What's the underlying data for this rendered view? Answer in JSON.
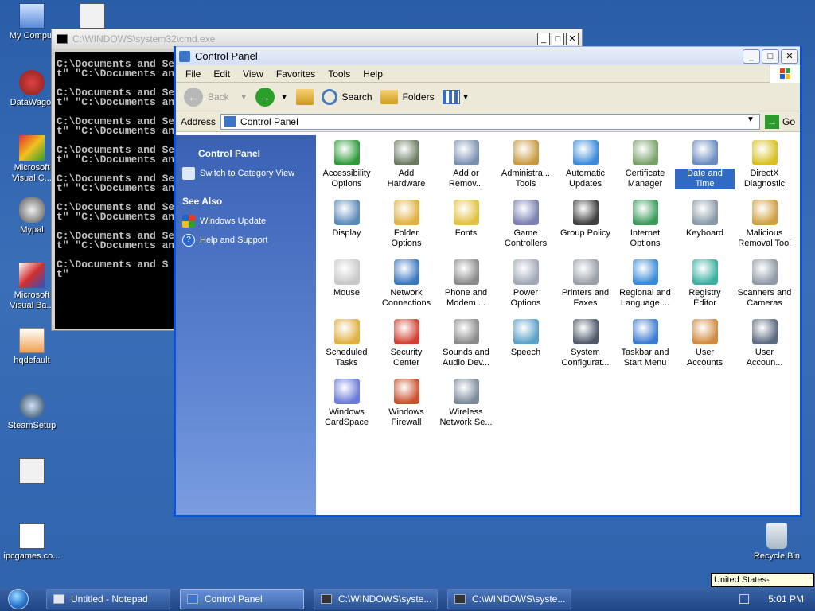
{
  "desktop": {
    "icons": [
      {
        "label": "My Comput",
        "icon": "my-computer-icon"
      },
      {
        "label": "",
        "icon": "cmd-shortcut-icon"
      },
      {
        "label": "DataWago.",
        "icon": "datawago-icon"
      },
      {
        "label": "Microsoft\nVisual C...",
        "icon": "visual-c-icon"
      },
      {
        "label": "Mypal",
        "icon": "mypal-icon"
      },
      {
        "label": "Microsoft\nVisual Ba...",
        "icon": "visual-basic-icon"
      },
      {
        "label": "hqdefault",
        "icon": "image-file-icon"
      },
      {
        "label": "SteamSetup",
        "icon": "steam-icon"
      },
      {
        "label": "",
        "icon": "app-shortcut-icon"
      },
      {
        "label": "ipcgames.co...",
        "icon": "text-file-icon"
      },
      {
        "label": "Recycle Bin",
        "icon": "recycle-bin-icon"
      }
    ]
  },
  "cmd_window": {
    "title": "C:\\WINDOWS\\system32\\cmd.exe",
    "lines": "C:\\Documents and Se\nt\" \"C:\\Documents an\n\nC:\\Documents and Se\nt\" \"C:\\Documents an\n\nC:\\Documents and Se\nt\" \"C:\\Documents an\n\nC:\\Documents and Se\nt\" \"C:\\Documents an\n\nC:\\Documents and Se\nt\" \"C:\\Documents an\n\nC:\\Documents and Se\nt\" \"C:\\Documents an\n\nC:\\Documents and Se\nt\" \"C:\\Documents an\n\nC:\\Documents and S\nt\""
  },
  "control_panel": {
    "title": "Control Panel",
    "menu": [
      "File",
      "Edit",
      "View",
      "Favorites",
      "Tools",
      "Help"
    ],
    "toolbar": {
      "back": "Back",
      "search": "Search",
      "folders": "Folders"
    },
    "address_label": "Address",
    "address_value": "Control Panel",
    "go_label": "Go",
    "sidebar": {
      "heading": "Control Panel",
      "switch_view": "Switch to Category View",
      "see_also": "See Also",
      "links": [
        "Windows Update",
        "Help and Support"
      ]
    },
    "items": [
      {
        "label": "Accessibility\nOptions",
        "icon": "accessibility-icon",
        "color": "#2f9a3a"
      },
      {
        "label": "Add\nHardware",
        "icon": "add-hardware-icon",
        "color": "#6a7a60"
      },
      {
        "label": "Add or\nRemov...",
        "icon": "add-remove-programs-icon",
        "color": "#7a8fb0"
      },
      {
        "label": "Administra...\nTools",
        "icon": "admin-tools-icon",
        "color": "#c89a40"
      },
      {
        "label": "Automatic\nUpdates",
        "icon": "automatic-updates-icon",
        "color": "#3a8ad8"
      },
      {
        "label": "Certificate\nManager",
        "icon": "certificate-icon",
        "color": "#7aa06a"
      },
      {
        "label": "Date and\nTime",
        "icon": "date-time-icon",
        "color": "#6a8ac0"
      },
      {
        "label": "DirectX\nDiagnostic",
        "icon": "directx-icon",
        "color": "#d8c020"
      },
      {
        "label": "Display",
        "icon": "display-icon",
        "color": "#5a8ab8"
      },
      {
        "label": "Folder\nOptions",
        "icon": "folder-options-icon",
        "color": "#e0b040"
      },
      {
        "label": "Fonts",
        "icon": "fonts-icon",
        "color": "#e0c040"
      },
      {
        "label": "Game\nControllers",
        "icon": "game-controllers-icon",
        "color": "#7a80b0"
      },
      {
        "label": "Group Policy",
        "icon": "group-policy-icon",
        "color": "#404040"
      },
      {
        "label": "Internet\nOptions",
        "icon": "internet-options-icon",
        "color": "#3a9a5a"
      },
      {
        "label": "Keyboard",
        "icon": "keyboard-icon",
        "color": "#8a9aa8"
      },
      {
        "label": "Malicious\nRemoval Tool",
        "icon": "malicious-removal-icon",
        "color": "#d0a040"
      },
      {
        "label": "Mouse",
        "icon": "mouse-icon",
        "color": "#c8c8c8"
      },
      {
        "label": "Network\nConnections",
        "icon": "network-connections-icon",
        "color": "#3a78c0"
      },
      {
        "label": "Phone and\nModem ...",
        "icon": "phone-modem-icon",
        "color": "#8a8a8a"
      },
      {
        "label": "Power\nOptions",
        "icon": "power-options-icon",
        "color": "#a0a8b8"
      },
      {
        "label": "Printers and\nFaxes",
        "icon": "printers-faxes-icon",
        "color": "#9aa0a8"
      },
      {
        "label": "Regional and\nLanguage ...",
        "icon": "regional-language-icon",
        "color": "#3a8ad8"
      },
      {
        "label": "Registry\nEditor",
        "icon": "registry-editor-icon",
        "color": "#3ab0a0"
      },
      {
        "label": "Scanners and\nCameras",
        "icon": "scanners-cameras-icon",
        "color": "#909aa8"
      },
      {
        "label": "Scheduled\nTasks",
        "icon": "scheduled-tasks-icon",
        "color": "#e0b040"
      },
      {
        "label": "Security\nCenter",
        "icon": "security-center-icon",
        "color": "#d04030"
      },
      {
        "label": "Sounds and\nAudio Dev...",
        "icon": "sounds-audio-icon",
        "color": "#8a8a8a"
      },
      {
        "label": "Speech",
        "icon": "speech-icon",
        "color": "#5aa0c8"
      },
      {
        "label": "System\nConfigurat...",
        "icon": "system-config-icon",
        "color": "#505a6a"
      },
      {
        "label": "Taskbar and\nStart Menu",
        "icon": "taskbar-start-icon",
        "color": "#3a7ad0"
      },
      {
        "label": "User\nAccounts",
        "icon": "user-accounts-icon",
        "color": "#d08a40"
      },
      {
        "label": "User\nAccoun...",
        "icon": "user-accounts-2-icon",
        "color": "#5a6a80"
      },
      {
        "label": "Windows\nCardSpace",
        "icon": "cardspace-icon",
        "color": "#6a7ad8"
      },
      {
        "label": "Windows\nFirewall",
        "icon": "firewall-icon",
        "color": "#c8502a"
      },
      {
        "label": "Wireless\nNetwork Se...",
        "icon": "wireless-network-icon",
        "color": "#7a8a9a"
      }
    ],
    "selected_index": 6
  },
  "taskbar": {
    "tasks": [
      {
        "label": "Untitled - Notepad",
        "active": false
      },
      {
        "label": "Control Panel",
        "active": true
      },
      {
        "label": "C:\\WINDOWS\\syste...",
        "active": false
      },
      {
        "label": "C:\\WINDOWS\\syste...",
        "active": false
      }
    ],
    "clock": "5:01 PM",
    "tooltip": "United States-International"
  }
}
